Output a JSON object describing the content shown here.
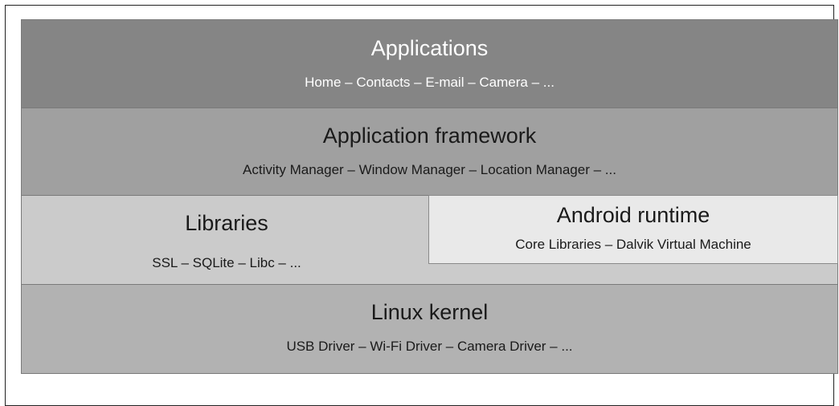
{
  "layers": {
    "applications": {
      "title": "Applications",
      "items": "Home – Contacts – E-mail – Camera – ..."
    },
    "framework": {
      "title": "Application framework",
      "items": "Activity Manager – Window Manager – Location Manager – ..."
    },
    "libraries": {
      "title": "Libraries",
      "items": "SSL – SQLite – Libc – ..."
    },
    "runtime": {
      "title": "Android runtime",
      "items": "Core Libraries – Dalvik Virtual Machine"
    },
    "kernel": {
      "title": "Linux kernel",
      "items": "USB Driver – Wi-Fi Driver – Camera Driver – ..."
    }
  }
}
